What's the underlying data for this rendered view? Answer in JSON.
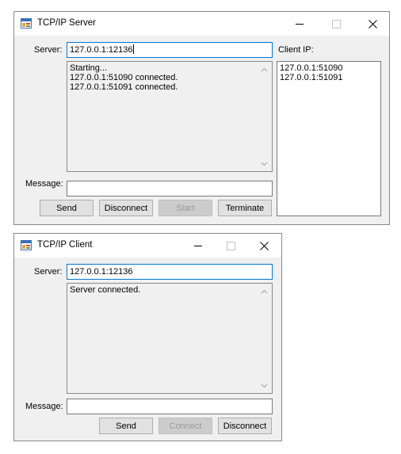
{
  "server_window": {
    "title": "TCP/IP Server",
    "server_label": "Server:",
    "server_value": "127.0.0.1:12136",
    "log_lines": [
      "Starting...",
      "127.0.0.1:51090 connected.",
      "127.0.0.1:51091 connected."
    ],
    "client_ip_label": "Client IP:",
    "client_ips": [
      "127.0.0.1:51090",
      "127.0.0.1:51091"
    ],
    "message_label": "Message:",
    "message_value": "",
    "buttons": {
      "send": "Send",
      "disconnect": "Disconnect",
      "start": "Start",
      "terminate": "Terminate"
    },
    "start_enabled": false
  },
  "client_window": {
    "title": "TCP/IP Client",
    "server_label": "Server:",
    "server_value": "127.0.0.1:12136",
    "log_lines": [
      "Server connected."
    ],
    "message_label": "Message:",
    "message_value": "",
    "buttons": {
      "send": "Send",
      "connect": "Connect",
      "disconnect": "Disconnect"
    },
    "connect_enabled": false
  },
  "icons": {
    "app": "app-window-icon",
    "minimize": "minimize-icon",
    "maximize": "maximize-icon",
    "close": "close-icon",
    "scroll_up": "chevron-up-icon",
    "scroll_down": "chevron-down-icon"
  },
  "colors": {
    "window_bg": "#f0f0f0",
    "focus_border": "#0078d7",
    "disabled_text": "#9a9a9a"
  }
}
